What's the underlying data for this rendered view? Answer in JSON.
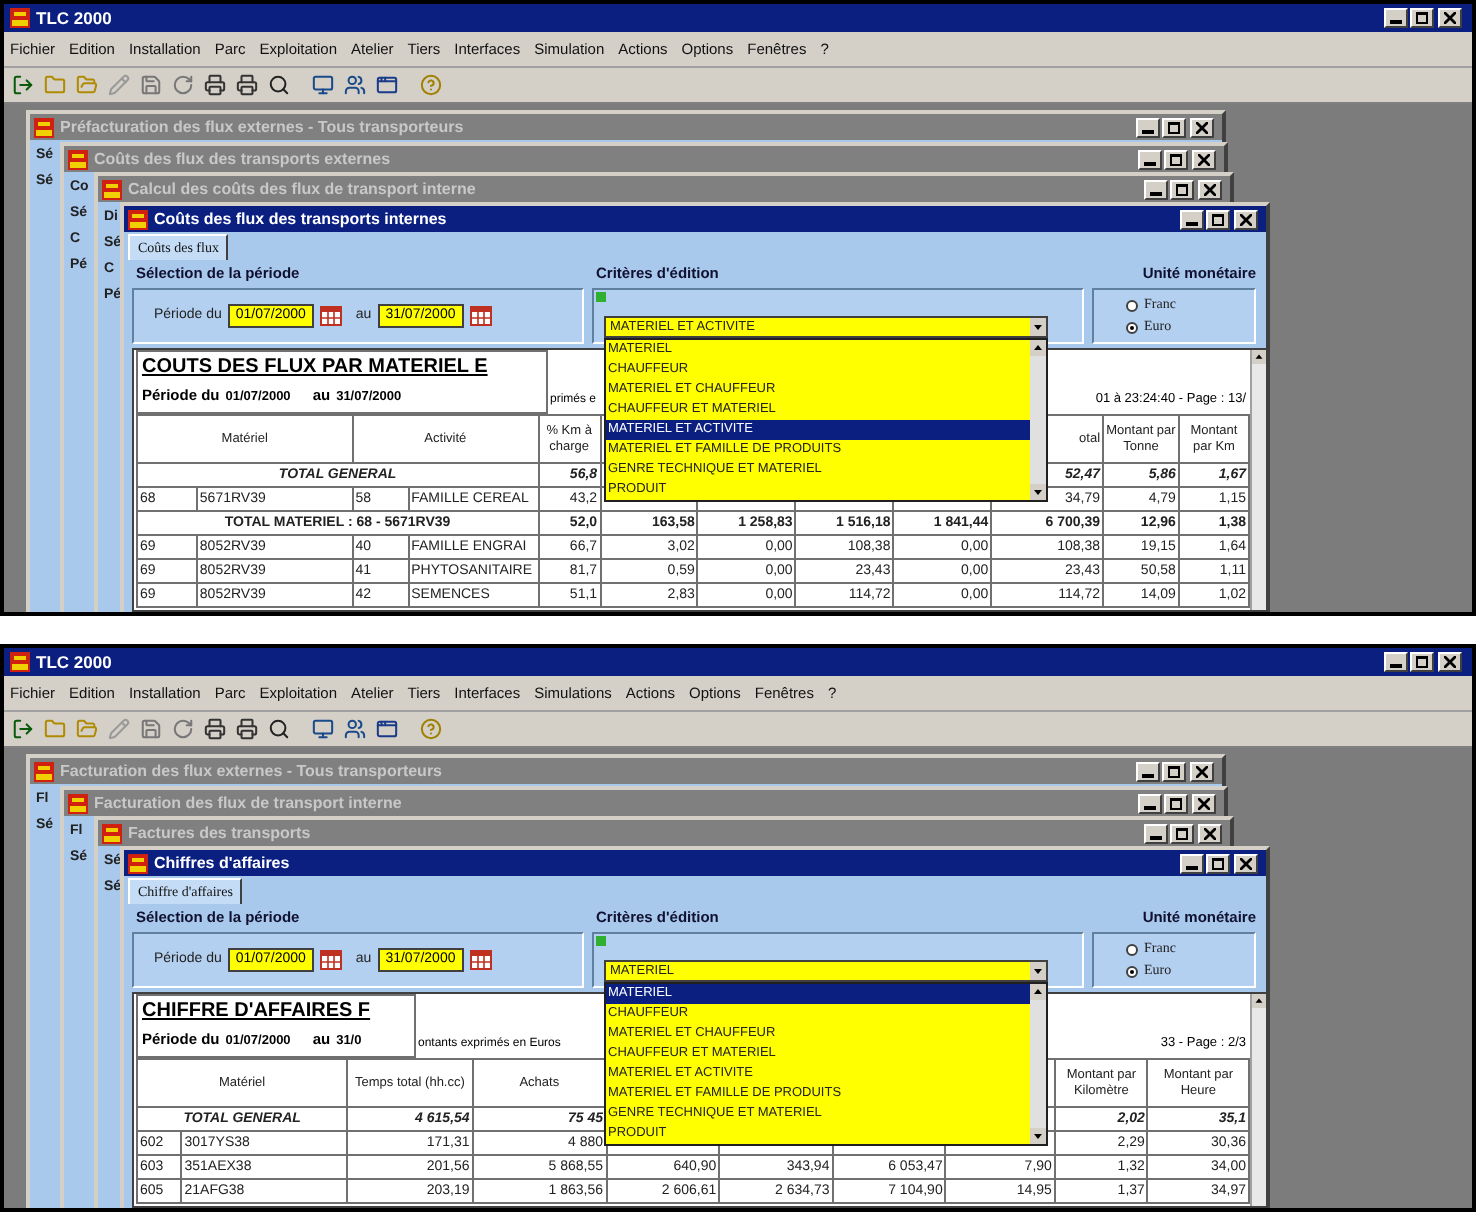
{
  "screens": [
    {
      "app_title": "TLC 2000",
      "menu": [
        "Fichier",
        "Edition",
        "Installation",
        "Parc",
        "Exploitation",
        "Atelier",
        "Tiers",
        "Interfaces",
        "Simulation",
        "Actions",
        "Options",
        "Fenêtres",
        "?"
      ],
      "background_windows": [
        {
          "title": "Préfacturation des flux externes - Tous transporteurs",
          "fragments": [
            "Sé",
            "Sé"
          ]
        },
        {
          "title": "Coûts des flux des transports externes",
          "fragments": [
            "Co",
            "Sé",
            "C",
            "Pé"
          ]
        },
        {
          "title": "Calcul des coûts des flux de transport interne",
          "fragments": [
            "Di",
            "Sé",
            "C",
            "Pé"
          ]
        }
      ],
      "front_window": {
        "title": "Coûts des flux des transports internes",
        "tabs": [
          {
            "label": "Coûts des flux",
            "selected": true
          }
        ],
        "period": {
          "heading": "Sélection de la période",
          "from_label": "Période du",
          "from": "01/07/2000",
          "to_label": "au",
          "to": "31/07/2000"
        },
        "criteria": {
          "heading": "Critères d'édition",
          "value": "MATERIEL ET ACTIVITE",
          "expanded": true,
          "options": [
            {
              "label": "MATERIEL",
              "selected": false
            },
            {
              "label": "CHAUFFEUR",
              "selected": false
            },
            {
              "label": "MATERIEL ET CHAUFFEUR",
              "selected": false
            },
            {
              "label": "CHAUFFEUR ET MATERIEL",
              "selected": false
            },
            {
              "label": "MATERIEL ET ACTIVITE",
              "selected": true
            },
            {
              "label": "MATERIEL ET FAMILLE DE PRODUITS",
              "selected": false
            },
            {
              "label": "GENRE TECHNIQUE ET MATERIEL",
              "selected": false
            },
            {
              "label": "PRODUIT",
              "selected": false
            }
          ]
        },
        "currency": {
          "heading": "Unité monétaire",
          "options": [
            {
              "label": "Franc",
              "selected": false
            },
            {
              "label": "Euro",
              "selected": true
            }
          ]
        },
        "report": {
          "title": "COUTS DES FLUX PAR MATERIEL E",
          "period_label": "Période du",
          "period_from": "01/07/2000",
          "period_to_label": "au",
          "period_to": "31/07/2000",
          "note": "primés e",
          "stamp": "01 à 23:24:40 - Page : 13/",
          "header": {
            "cells": [
              {
                "text": "Matériel",
                "colspan": 2
              },
              {
                "text": "Activité",
                "colspan": 2
              },
              {
                "text": "% Km à charge"
              }
            ],
            "tail": [
              {
                "text": "otal"
              },
              {
                "text": "Montant par Tonne"
              },
              {
                "text": "Montant par Km"
              }
            ]
          },
          "rows": [
            {
              "kind": "total",
              "cells": [
                {
                  "text": "TOTAL GENERAL",
                  "colspan": 4
                },
                "56,8"
              ],
              "tail": [
                "52,47",
                "5,86",
                "1,67"
              ]
            },
            {
              "kind": "data",
              "cells": [
                "68",
                "5671RV39",
                "58",
                "FAMILLE CEREAL",
                "43,2"
              ],
              "tail": [
                "34,79",
                "4,79",
                "1,15"
              ]
            },
            {
              "kind": "subtotal",
              "cells": [
                {
                  "text": "TOTAL MATERIEL : 68 - 5671RV39",
                  "colspan": 4
                },
                "52,0",
                "163,58",
                "1 258,83",
                "1 516,18",
                "1 841,44",
                "6 700,39",
                "12,96",
                "1,38"
              ],
              "tail": []
            },
            {
              "kind": "data",
              "cells": [
                "69",
                "8052RV39",
                "40",
                "FAMILLE ENGRAI",
                "66,7",
                "3,02",
                "0,00",
                "108,38",
                "0,00",
                "108,38",
                "19,15",
                "1,64"
              ],
              "tail": []
            },
            {
              "kind": "data",
              "cells": [
                "69",
                "8052RV39",
                "41",
                "PHYTOSANITAIRE",
                "81,7",
                "0,59",
                "0,00",
                "23,43",
                "0,00",
                "23,43",
                "50,58",
                "1,11"
              ],
              "tail": []
            },
            {
              "kind": "data",
              "cells": [
                "69",
                "8052RV39",
                "42",
                "SEMENCES",
                "51,1",
                "2,83",
                "0,00",
                "114,72",
                "0,00",
                "114,72",
                "14,09",
                "1,02"
              ],
              "tail": []
            }
          ]
        }
      }
    },
    {
      "app_title": "TLC 2000",
      "menu": [
        "Fichier",
        "Edition",
        "Installation",
        "Parc",
        "Exploitation",
        "Atelier",
        "Tiers",
        "Interfaces",
        "Simulations",
        "Actions",
        "Options",
        "Fenêtres",
        "?"
      ],
      "background_windows": [
        {
          "title": "Facturation des flux externes - Tous transporteurs",
          "fragments": [
            "Fl",
            "Sé"
          ]
        },
        {
          "title": "Facturation des flux de transport interne",
          "fragments": [
            "Fl",
            "Sé"
          ]
        },
        {
          "title": "Factures des transports",
          "fragments": [
            "Sé",
            "Sé"
          ]
        }
      ],
      "front_window": {
        "title": "Chiffres d'affaires",
        "tabs": [
          {
            "label": "Chiffre d'affaires",
            "selected": true
          }
        ],
        "period": {
          "heading": "Sélection de la période",
          "from_label": "Période du",
          "from": "01/07/2000",
          "to_label": "au",
          "to": "31/07/2000"
        },
        "criteria": {
          "heading": "Critères d'édition",
          "value": "MATERIEL",
          "expanded": true,
          "options": [
            {
              "label": "MATERIEL",
              "selected": true
            },
            {
              "label": "CHAUFFEUR",
              "selected": false
            },
            {
              "label": "MATERIEL ET CHAUFFEUR",
              "selected": false
            },
            {
              "label": "CHAUFFEUR ET MATERIEL",
              "selected": false
            },
            {
              "label": "MATERIEL ET ACTIVITE",
              "selected": false
            },
            {
              "label": "MATERIEL ET FAMILLE DE PRODUITS",
              "selected": false
            },
            {
              "label": "GENRE TECHNIQUE ET MATERIEL",
              "selected": false
            },
            {
              "label": "PRODUIT",
              "selected": false
            }
          ]
        },
        "currency": {
          "heading": "Unité monétaire",
          "options": [
            {
              "label": "Franc",
              "selected": false
            },
            {
              "label": "Euro",
              "selected": true
            }
          ]
        },
        "report": {
          "title": "CHIFFRE D'AFFAIRES F",
          "period_label": "Période du",
          "period_from": "01/07/2000",
          "period_to_label": "au",
          "period_to": "31/0",
          "note": "ontants exprimés en Euros",
          "stamp": "33 - Page : 2/3",
          "header": {
            "cells": [
              {
                "text": "Matériel",
                "colspan": 2
              },
              {
                "text": "Temps total (hh.cc)"
              },
              {
                "text": "Achats"
              }
            ],
            "tail": [
              {
                "text": "Montant par Kilomètre"
              },
              {
                "text": "Montant par Heure"
              }
            ]
          },
          "rows": [
            {
              "kind": "total",
              "cells": [
                {
                  "text": "TOTAL GENERAL",
                  "colspan": 2
                },
                "4 615,54",
                "75 45"
              ],
              "tail": [
                "2,02",
                "35,1"
              ]
            },
            {
              "kind": "data",
              "cells": [
                "602",
                "3017YS38",
                "171,31",
                "4 880"
              ],
              "tail": [
                "2,29",
                "30,36"
              ]
            },
            {
              "kind": "data",
              "cells": [
                "603",
                "351AEX38",
                "201,56",
                "5 868,55",
                "640,90",
                "343,94",
                "6 053,47",
                "7,90",
                "1,32",
                "34,00"
              ],
              "tail": []
            },
            {
              "kind": "data",
              "cells": [
                "605",
                "21AFG38",
                "203,19",
                "1 863,56",
                "2 606,61",
                "2 634,73",
                "7 104,90",
                "14,95",
                "1,37",
                "34,97"
              ],
              "tail": []
            }
          ]
        }
      }
    }
  ]
}
